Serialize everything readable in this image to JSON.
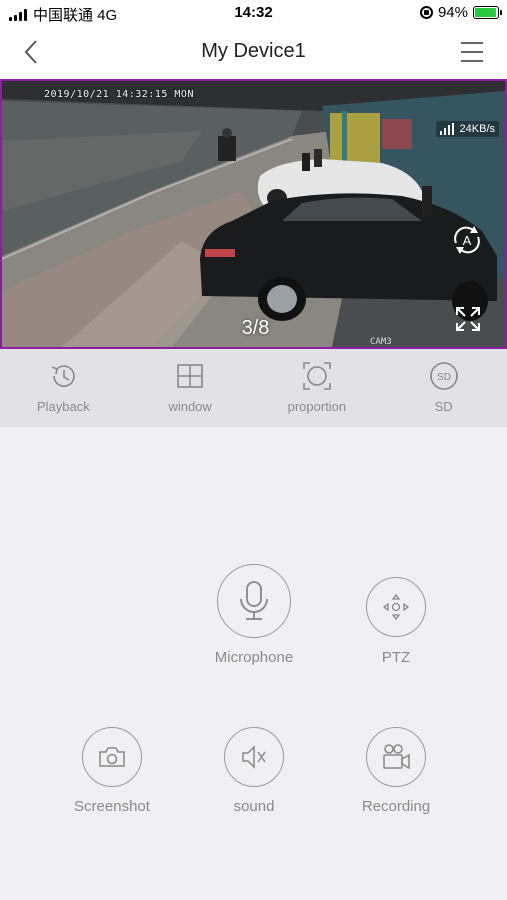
{
  "status_bar": {
    "carrier": "中国联通 4G",
    "time": "14:32",
    "battery_percent": "94%"
  },
  "nav": {
    "title": "My Device1"
  },
  "video": {
    "timestamp": "2019/10/21 14:32:15 MON",
    "speed": "24KB/s",
    "page_indicator": "3/8",
    "camera_label": "CAM3"
  },
  "toolbar": {
    "items": [
      {
        "label": "Playback",
        "icon": "playback-history-icon"
      },
      {
        "label": "window",
        "icon": "window-grid-icon"
      },
      {
        "label": "proportion",
        "icon": "proportion-icon"
      },
      {
        "label": "SD",
        "icon": "sd-card-icon"
      }
    ]
  },
  "controls": {
    "microphone": "Microphone",
    "ptz": "PTZ",
    "screenshot": "Screenshot",
    "sound": "sound",
    "recording": "Recording"
  },
  "colors": {
    "video_border": "#8b1fa0",
    "toolbar_bg": "#e2e2e4",
    "page_bg": "#f0eff4",
    "battery": "#2bc840"
  }
}
